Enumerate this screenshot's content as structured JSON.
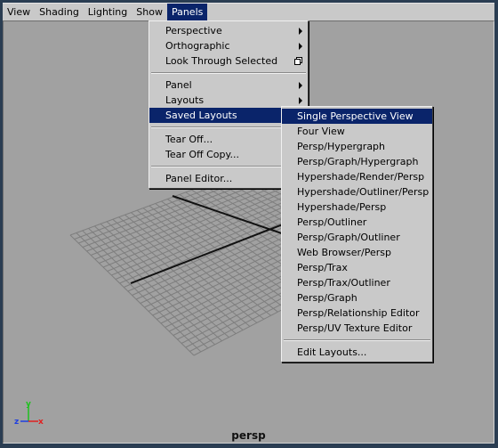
{
  "menubar": {
    "items": [
      "View",
      "Shading",
      "Lighting",
      "Show",
      "Panels"
    ],
    "active": "Panels"
  },
  "panels_menu": {
    "items": [
      {
        "label": "Perspective",
        "submenu": true
      },
      {
        "label": "Orthographic",
        "submenu": true
      },
      {
        "label": "Look Through Selected",
        "option_box": true
      },
      {
        "separator": true
      },
      {
        "label": "Panel",
        "submenu": true
      },
      {
        "label": "Layouts",
        "submenu": true
      },
      {
        "label": "Saved Layouts",
        "submenu": true,
        "highlight": true
      },
      {
        "separator": true
      },
      {
        "label": "Tear Off..."
      },
      {
        "label": "Tear Off Copy..."
      },
      {
        "separator": true
      },
      {
        "label": "Panel Editor..."
      }
    ]
  },
  "saved_layouts_menu": {
    "items": [
      {
        "label": "Single Perspective View",
        "highlight": true
      },
      {
        "label": "Four View"
      },
      {
        "label": "Persp/Hypergraph"
      },
      {
        "label": "Persp/Graph/Hypergraph"
      },
      {
        "label": "Hypershade/Render/Persp"
      },
      {
        "label": "Hypershade/Outliner/Persp"
      },
      {
        "label": "Hypershade/Persp"
      },
      {
        "label": "Persp/Outliner"
      },
      {
        "label": "Persp/Graph/Outliner"
      },
      {
        "label": "Web Browser/Persp"
      },
      {
        "label": "Persp/Trax"
      },
      {
        "label": "Persp/Trax/Outliner"
      },
      {
        "label": "Persp/Graph"
      },
      {
        "label": "Persp/Relationship Editor"
      },
      {
        "label": "Persp/UV Texture Editor"
      },
      {
        "separator": true
      },
      {
        "label": "Edit Layouts..."
      }
    ]
  },
  "viewport": {
    "camera_label": "persp",
    "background_color": "#a1a1a1",
    "axis_labels": {
      "x": "x",
      "y": "y",
      "z": "z"
    },
    "axis_colors": {
      "x": "#e02020",
      "y": "#20c020",
      "z": "#2040e0"
    }
  },
  "colors": {
    "menu_bg": "#c9c9c9",
    "highlight": "#0a246a",
    "frame": "#2a3d52"
  }
}
